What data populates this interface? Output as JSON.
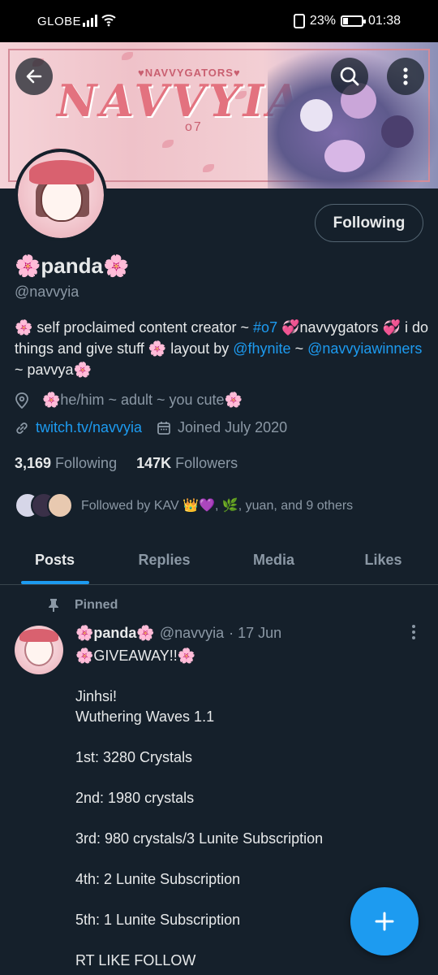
{
  "status_bar": {
    "carrier": "GLOBE",
    "battery": "23%",
    "time": "01:38"
  },
  "banner": {
    "brand_text": "NAVVYIA",
    "sub_text": "♥NAVVYGATORS♥",
    "tag_text": "o7"
  },
  "profile": {
    "name": "🌸panda🌸",
    "handle": "@navvyia",
    "follow_button": "Following",
    "bio": {
      "part1": "🌸 self proclaimed content creator ~ ",
      "hashtag": "#o7",
      "part2": " 💞navvygators 💞 i do things and give stuff 🌸 layout by ",
      "mention1": "@fhynite",
      "part3": " ~ ",
      "mention2": "@navvyiawinners",
      "part4": " ~ pavvya🌸"
    },
    "location": "🌸he/him ~ adult ~ you cute🌸",
    "website": "twitch.tv/navvyia",
    "joined": "Joined July 2020",
    "following_count": "3,169",
    "following_label": "Following",
    "followers_count": "147K",
    "followers_label": "Followers",
    "followed_by": "Followed by KAV 👑💜, 🌿, yuan, and 9 others"
  },
  "tabs": [
    "Posts",
    "Replies",
    "Media",
    "Likes"
  ],
  "pinned_post": {
    "pinned_label": "Pinned",
    "author_name": "🌸panda🌸",
    "author_handle": "@navvyia",
    "date": "· 17 Jun",
    "lines": [
      "🌸GIVEAWAY!!🌸",
      "",
      "Jinhsi!",
      "Wuthering Waves 1.1",
      "",
      "1st: 3280 Crystals",
      "",
      "2nd: 1980 crystals",
      "",
      "3rd: 980 crystals/3 Lunite Subscription",
      "",
      "4th: 2 Lunite Subscription",
      "",
      "5th: 1 Lunite Subscription",
      "",
      "RT LIKE FOLLOW"
    ]
  },
  "colors": {
    "background": "#15202b",
    "accent": "#1d9bf0",
    "muted": "#8b98a5"
  }
}
